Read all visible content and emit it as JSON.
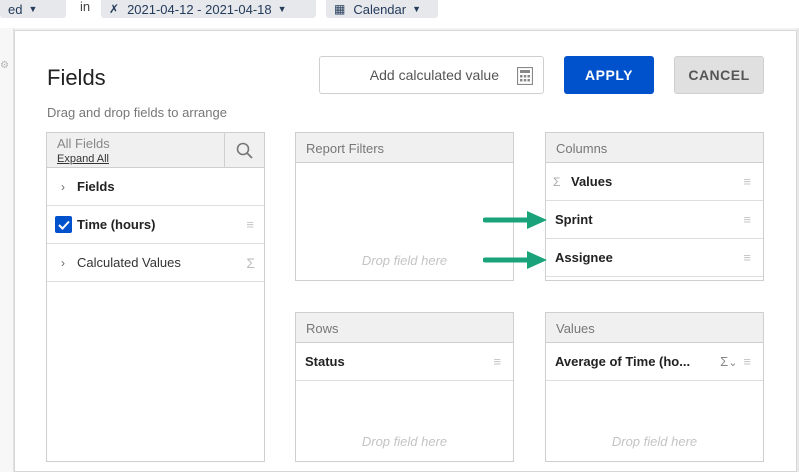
{
  "toolbar": {
    "status_filter": "ed",
    "in_label": "in",
    "date_range": "2021-04-12 - 2021-04-18",
    "calendar_label": "Calendar"
  },
  "dialog": {
    "title": "Fields",
    "subtitle": "Drag and drop fields to arrange",
    "add_calculated_label": "Add calculated value",
    "apply_label": "APPLY",
    "cancel_label": "CANCEL"
  },
  "all_fields": {
    "header": "All Fields",
    "expand_all": "Expand All",
    "items": [
      {
        "label": "Fields",
        "type": "group"
      },
      {
        "label": "Time (hours)",
        "type": "field",
        "checked": true
      },
      {
        "label": "Calculated Values",
        "type": "group"
      }
    ]
  },
  "report_filters": {
    "header": "Report Filters",
    "drop_hint": "Drop field here"
  },
  "columns": {
    "header": "Columns",
    "items": [
      "Values",
      "Sprint",
      "Assignee"
    ]
  },
  "rows": {
    "header": "Rows",
    "items": [
      "Status"
    ],
    "drop_hint": "Drop field here"
  },
  "values": {
    "header": "Values",
    "items": [
      "Average of Time (ho..."
    ],
    "drop_hint": "Drop field here"
  },
  "colors": {
    "primary": "#0052cc",
    "arrow": "#1aa37a"
  }
}
